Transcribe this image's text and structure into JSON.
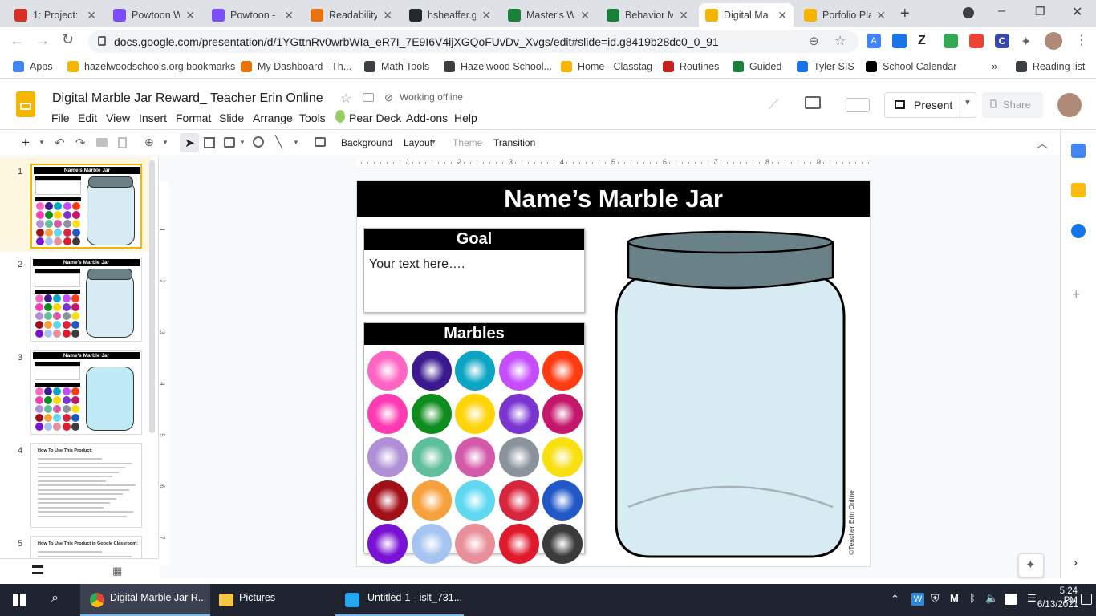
{
  "browser": {
    "tabs": [
      {
        "title": "1: Project: \\",
        "favicon_color": "#d93025"
      },
      {
        "title": "Powtoon W",
        "favicon_color": "#7b4dff"
      },
      {
        "title": "Powtoon -",
        "favicon_color": "#7b4dff"
      },
      {
        "title": "Readability",
        "favicon_color": "#e8710a"
      },
      {
        "title": "hsheaffer.g",
        "favicon_color": "#24292e"
      },
      {
        "title": "Master's W",
        "favicon_color": "#188038"
      },
      {
        "title": "Behavior M",
        "favicon_color": "#188038"
      },
      {
        "title": "Digital Ma",
        "favicon_color": "#f4b400"
      },
      {
        "title": "Porfolio Pla",
        "favicon_color": "#f4b400"
      }
    ],
    "url": "docs.google.com/presentation/d/1YGttnRv0wrbWIa_eR7I_7E9I6V4ijXGQoFUvDv_Xvgs/edit#slide=id.g8419b28dc0_0_91",
    "bookmarks": [
      {
        "label": "Apps",
        "color": "#4285f4"
      },
      {
        "label": "hazelwoodschools.org bookmarks",
        "color": "#f4b400"
      },
      {
        "label": "My Dashboard - Th...",
        "color": "#e8710a"
      },
      {
        "label": "Math Tools",
        "color": "#3c4043"
      },
      {
        "label": "Hazelwood School...",
        "color": "#3c4043"
      },
      {
        "label": "Home - Classtag",
        "color": "#f4b400"
      },
      {
        "label": "Routines",
        "color": "#c5221f"
      },
      {
        "label": "Guided",
        "color": "#188038"
      },
      {
        "label": "Tyler SIS",
        "color": "#1a73e8"
      },
      {
        "label": "School Calendar",
        "color": "#000000"
      },
      {
        "label": "Reading list",
        "color": "#3c4043"
      }
    ]
  },
  "doc": {
    "title": "Digital Marble Jar Reward_ Teacher Erin Online",
    "status": "Working offline",
    "menu": [
      "File",
      "Edit",
      "View",
      "Insert",
      "Format",
      "Slide",
      "Arrange",
      "Tools",
      "Pear Deck",
      "Add-ons",
      "Help"
    ],
    "present_label": "Present",
    "share_label": "Share"
  },
  "toolbar": {
    "background_label": "Background",
    "layout_label": "Layout",
    "theme_label": "Theme",
    "transition_label": "Transition",
    "ruler_numbers": [
      "1",
      "2",
      "3",
      "4",
      "5",
      "6",
      "7",
      "8",
      "9"
    ],
    "vruler_numbers": [
      "1",
      "2",
      "3",
      "4",
      "5",
      "6",
      "7"
    ]
  },
  "filmstrip": {
    "slides": [
      {
        "num": "1",
        "title": "Name's Marble Jar"
      },
      {
        "num": "2",
        "title": "Name's Marble Jar"
      },
      {
        "num": "3",
        "title": "Name's Marble Jar"
      },
      {
        "num": "4",
        "title": "How To Use This Product:"
      },
      {
        "num": "5",
        "title": "How To Use This Product in Google Classroom:"
      }
    ]
  },
  "slide": {
    "title": "Name’s Marble Jar",
    "goal_header": "Goal",
    "goal_text": "Your text here….",
    "marbles_header": "Marbles",
    "watermark": "©Teacher Erin Online",
    "marble_colors": [
      "#ff66c4",
      "#3b1a8f",
      "#0aa5c2",
      "#c54dff",
      "#ff3b12",
      "#ff3bb4",
      "#0f8c1e",
      "#ffd50a",
      "#7a35d1",
      "#c4166b",
      "#b08fd6",
      "#5fbf9a",
      "#d35aa8",
      "#8a939c",
      "#f7df10",
      "#a30f18",
      "#f7a13c",
      "#5fd8f2",
      "#d8253e",
      "#2257c8",
      "#7a12d6",
      "#a5c4f2",
      "#e98f9a",
      "#e01a2c",
      "#3b3b3b"
    ]
  },
  "taskbar": {
    "items": [
      "Digital Marble Jar R...",
      "Pictures",
      "Untitled-1 - islt_731..."
    ],
    "time": "5:24 PM",
    "date": "6/13/2021"
  }
}
